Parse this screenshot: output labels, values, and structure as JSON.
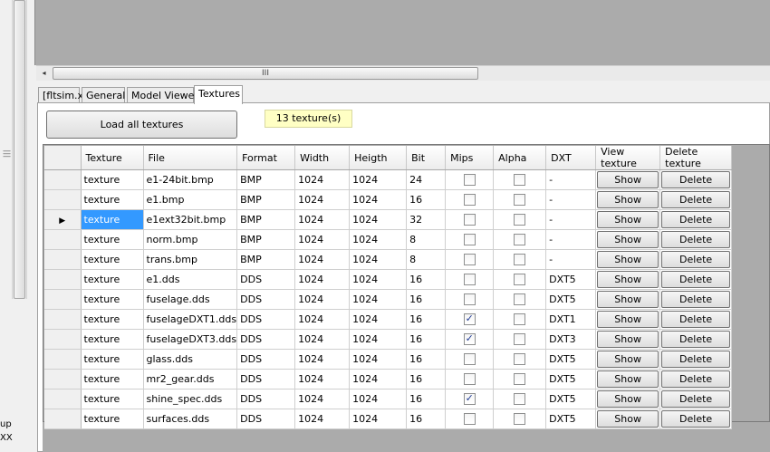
{
  "left_panel": {
    "label_up": "up",
    "label_x": "XX"
  },
  "scroll": {
    "thumb_grip": "III",
    "left_arrow": "◂"
  },
  "tabs": [
    "[fltsim.x]",
    "General",
    "Model Viewer",
    "Textures"
  ],
  "active_tab": 3,
  "textures_tab": {
    "load_button": "Load all textures",
    "count_label": "13 texture(s)"
  },
  "grid": {
    "columns": [
      "Texture",
      "File",
      "Format",
      "Width",
      "Heigth",
      "Bit",
      "Mips",
      "Alpha",
      "DXT",
      "View texture",
      "Delete texture"
    ],
    "current_row_marker": "▶",
    "selected_row": 2,
    "show_label": "Show",
    "delete_label": "Delete",
    "rows": [
      {
        "texture": "texture",
        "file": "e1-24bit.bmp",
        "format": "BMP",
        "width": "1024",
        "height": "1024",
        "bit": "24",
        "mips": false,
        "alpha": false,
        "dxt": "-"
      },
      {
        "texture": "texture",
        "file": "e1.bmp",
        "format": "BMP",
        "width": "1024",
        "height": "1024",
        "bit": "16",
        "mips": false,
        "alpha": false,
        "dxt": "-"
      },
      {
        "texture": "texture",
        "file": "e1ext32bit.bmp",
        "format": "BMP",
        "width": "1024",
        "height": "1024",
        "bit": "32",
        "mips": false,
        "alpha": false,
        "dxt": "-"
      },
      {
        "texture": "texture",
        "file": "norm.bmp",
        "format": "BMP",
        "width": "1024",
        "height": "1024",
        "bit": "8",
        "mips": false,
        "alpha": false,
        "dxt": "-"
      },
      {
        "texture": "texture",
        "file": "trans.bmp",
        "format": "BMP",
        "width": "1024",
        "height": "1024",
        "bit": "8",
        "mips": false,
        "alpha": false,
        "dxt": "-"
      },
      {
        "texture": "texture",
        "file": "e1.dds",
        "format": "DDS",
        "width": "1024",
        "height": "1024",
        "bit": "16",
        "mips": false,
        "alpha": false,
        "dxt": "DXT5"
      },
      {
        "texture": "texture",
        "file": "fuselage.dds",
        "format": "DDS",
        "width": "1024",
        "height": "1024",
        "bit": "16",
        "mips": false,
        "alpha": false,
        "dxt": "DXT5"
      },
      {
        "texture": "texture",
        "file": "fuselageDXT1.dds",
        "format": "DDS",
        "width": "1024",
        "height": "1024",
        "bit": "16",
        "mips": true,
        "alpha": false,
        "dxt": "DXT1"
      },
      {
        "texture": "texture",
        "file": "fuselageDXT3.dds",
        "format": "DDS",
        "width": "1024",
        "height": "1024",
        "bit": "16",
        "mips": true,
        "alpha": false,
        "dxt": "DXT3"
      },
      {
        "texture": "texture",
        "file": "glass.dds",
        "format": "DDS",
        "width": "1024",
        "height": "1024",
        "bit": "16",
        "mips": false,
        "alpha": false,
        "dxt": "DXT5"
      },
      {
        "texture": "texture",
        "file": "mr2_gear.dds",
        "format": "DDS",
        "width": "1024",
        "height": "1024",
        "bit": "16",
        "mips": false,
        "alpha": false,
        "dxt": "DXT5"
      },
      {
        "texture": "texture",
        "file": "shine_spec.dds",
        "format": "DDS",
        "width": "1024",
        "height": "1024",
        "bit": "16",
        "mips": true,
        "alpha": false,
        "dxt": "DXT5"
      },
      {
        "texture": "texture",
        "file": "surfaces.dds",
        "format": "DDS",
        "width": "1024",
        "height": "1024",
        "bit": "16",
        "mips": false,
        "alpha": false,
        "dxt": "DXT5"
      }
    ]
  }
}
